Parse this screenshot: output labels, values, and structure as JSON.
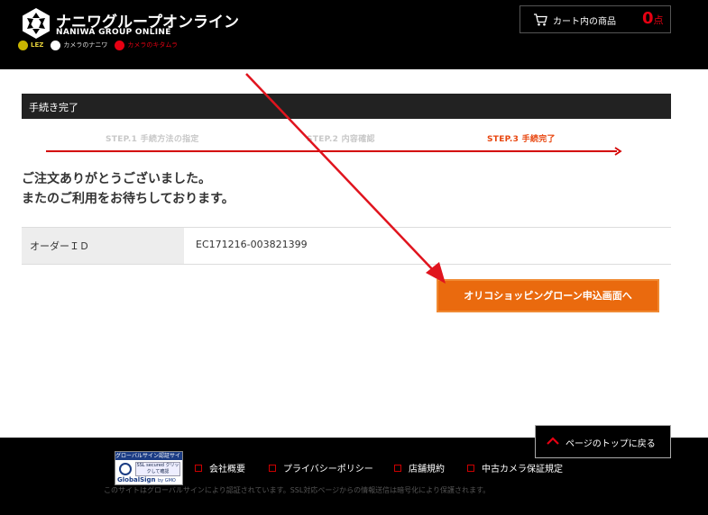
{
  "header": {
    "logo_text_jp": "ナニワグループオンライン",
    "logo_text_en": "NANIWA GROUP ONLINE",
    "sub_logos": [
      "LEZ",
      "カメラのナニワ",
      "カメラのキタムラ"
    ],
    "cart": {
      "label": "カート内の商品",
      "count": "0",
      "unit": "点"
    }
  },
  "main": {
    "section_title": "手続き完了",
    "steps": [
      {
        "label": "STEP.1 手続方法の指定",
        "state": "done"
      },
      {
        "label": "STEP.2 内容確認",
        "state": "done"
      },
      {
        "label": "STEP.3 手続完了",
        "state": "current"
      }
    ],
    "thanks_line1": "ご注文ありがとうございました。",
    "thanks_line2": "またのご利用をお待ちしております。",
    "order": {
      "label": "オーダーＩＤ",
      "value": "EC171216-003821399"
    },
    "loan_button_label": "オリコショッピングローン申込画面へ"
  },
  "page_top_label": "ページのトップに戻る",
  "footer": {
    "badge": {
      "top": "グローバルサイン認証サイト",
      "ssl": "SSL secured クリックして確認",
      "brand": "GlobalSign",
      "by": "by GMO"
    },
    "links": [
      "会社概要",
      "プライバシーポリシー",
      "店舗規約",
      "中古カメラ保証規定"
    ],
    "note": "このサイトはグローバルサインにより認証されています。SSL対応ページからの情報送信は暗号化により保護されます。"
  },
  "colors": {
    "accent_orange": "#ea6a0e",
    "step_active": "#e8450e",
    "annotation_red": "#e0141e",
    "cart_count": "#e60012"
  }
}
